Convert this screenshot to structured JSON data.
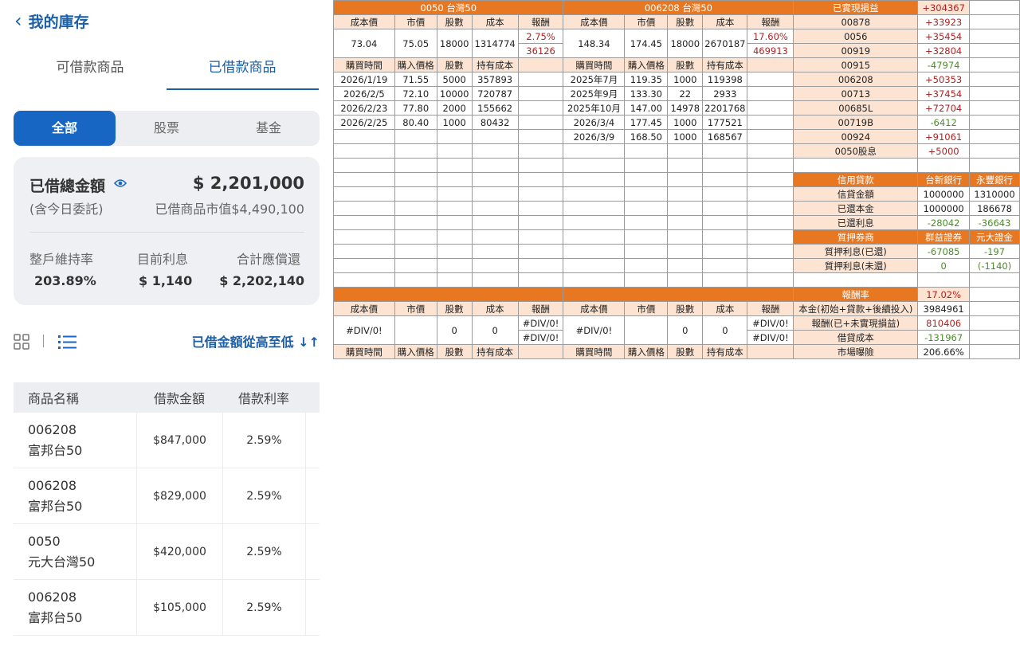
{
  "app": {
    "back_label": "我的庫存",
    "tabs": [
      "可借款商品",
      "已借款商品"
    ],
    "filters": [
      "全部",
      "股票",
      "基金"
    ]
  },
  "summary": {
    "title": "已借總金額",
    "amount": "$ 2,201,000",
    "note": "(含今日委託)",
    "market_value": "已借商品市值$4,490,100",
    "metrics": [
      {
        "label": "整戶維持率",
        "value": "203.89%"
      },
      {
        "label": "目前利息",
        "value": "$ 1,140"
      },
      {
        "label": "合計應償還",
        "value": "$ 2,202,140"
      }
    ]
  },
  "sort_label": "已借金額從高至低",
  "loan_table": {
    "headers": [
      "商品名稱",
      "借款金額",
      "借款利率"
    ],
    "rows": [
      {
        "code": "006208",
        "name": "富邦台50",
        "amount": "$847,000",
        "rate": "2.59%"
      },
      {
        "code": "006208",
        "name": "富邦台50",
        "amount": "$829,000",
        "rate": "2.59%"
      },
      {
        "code": "0050",
        "name": "元大台灣50",
        "amount": "$420,000",
        "rate": "2.59%"
      },
      {
        "code": "006208",
        "name": "富邦台50",
        "amount": "$105,000",
        "rate": "2.59%"
      }
    ]
  },
  "sheet": {
    "fund1_title": "0050 台灣50",
    "fund2_title": "006208 台灣50",
    "h1": [
      "成本價",
      "市價",
      "股數",
      "成本",
      "報酬"
    ],
    "h2": [
      "購買時間",
      "購入價格",
      "股數",
      "持有成本"
    ],
    "fund1_summary": [
      "73.04",
      "75.05",
      "18000",
      "1314774",
      "2.75%",
      "36126"
    ],
    "fund2_summary": [
      "148.34",
      "174.45",
      "18000",
      "2670187",
      "17.60%",
      "469913"
    ],
    "fund1_buys": [
      [
        "2026/1/19",
        "71.55",
        "5000",
        "357893"
      ],
      [
        "2026/2/5",
        "72.10",
        "10000",
        "720787"
      ],
      [
        "2026/2/23",
        "77.80",
        "2000",
        "155662"
      ],
      [
        "2026/2/25",
        "80.40",
        "1000",
        "80432"
      ]
    ],
    "fund2_buys": [
      [
        "2025年7月",
        "119.35",
        "1000",
        "119398"
      ],
      [
        "2025年9月",
        "133.30",
        "22",
        "2933"
      ],
      [
        "2025年10月",
        "147.00",
        "14978",
        "2201768"
      ],
      [
        "2026/3/4",
        "177.45",
        "1000",
        "177521"
      ],
      [
        "2026/3/9",
        "168.50",
        "1000",
        "168567"
      ]
    ],
    "div0": "#DIV/0!",
    "zero": "0",
    "realized": {
      "title": "已實現損益",
      "total": "+304367",
      "rows": [
        [
          "00878",
          "+33923"
        ],
        [
          "0056",
          "+35454"
        ],
        [
          "00919",
          "+32804"
        ],
        [
          "00915",
          "-47974"
        ],
        [
          "006208",
          "+50353"
        ],
        [
          "00713",
          "+37454"
        ],
        [
          "00685L",
          "+72704"
        ],
        [
          "00719B",
          "-6412"
        ],
        [
          "00924",
          "+91061"
        ],
        [
          "0050股息",
          "+5000"
        ]
      ]
    },
    "credit": {
      "headers": [
        "信用貸款",
        "台新銀行",
        "永豐銀行"
      ],
      "rows": [
        [
          "信貸金額",
          "1000000",
          "1310000"
        ],
        [
          "已還本金",
          "1000000",
          "186678"
        ],
        [
          "已還利息",
          "-28042",
          "-36643"
        ]
      ],
      "pledge_headers": [
        "質押券商",
        "群益證券",
        "元大證金"
      ],
      "pledge_rows": [
        [
          "質押利息(已還)",
          "-67085",
          "-197"
        ],
        [
          "質押利息(未還)",
          "0",
          "(-1140)"
        ]
      ]
    },
    "ret": {
      "label": "報酬率",
      "value": "17.02%",
      "rows": [
        [
          "本金(初始+貸款+後續投入)",
          "3984961"
        ],
        [
          "報酬(已+未實現損益)",
          "810406"
        ],
        [
          "借貸成本",
          "-131967"
        ],
        [
          "市場曝險",
          "206.66%"
        ]
      ]
    }
  }
}
